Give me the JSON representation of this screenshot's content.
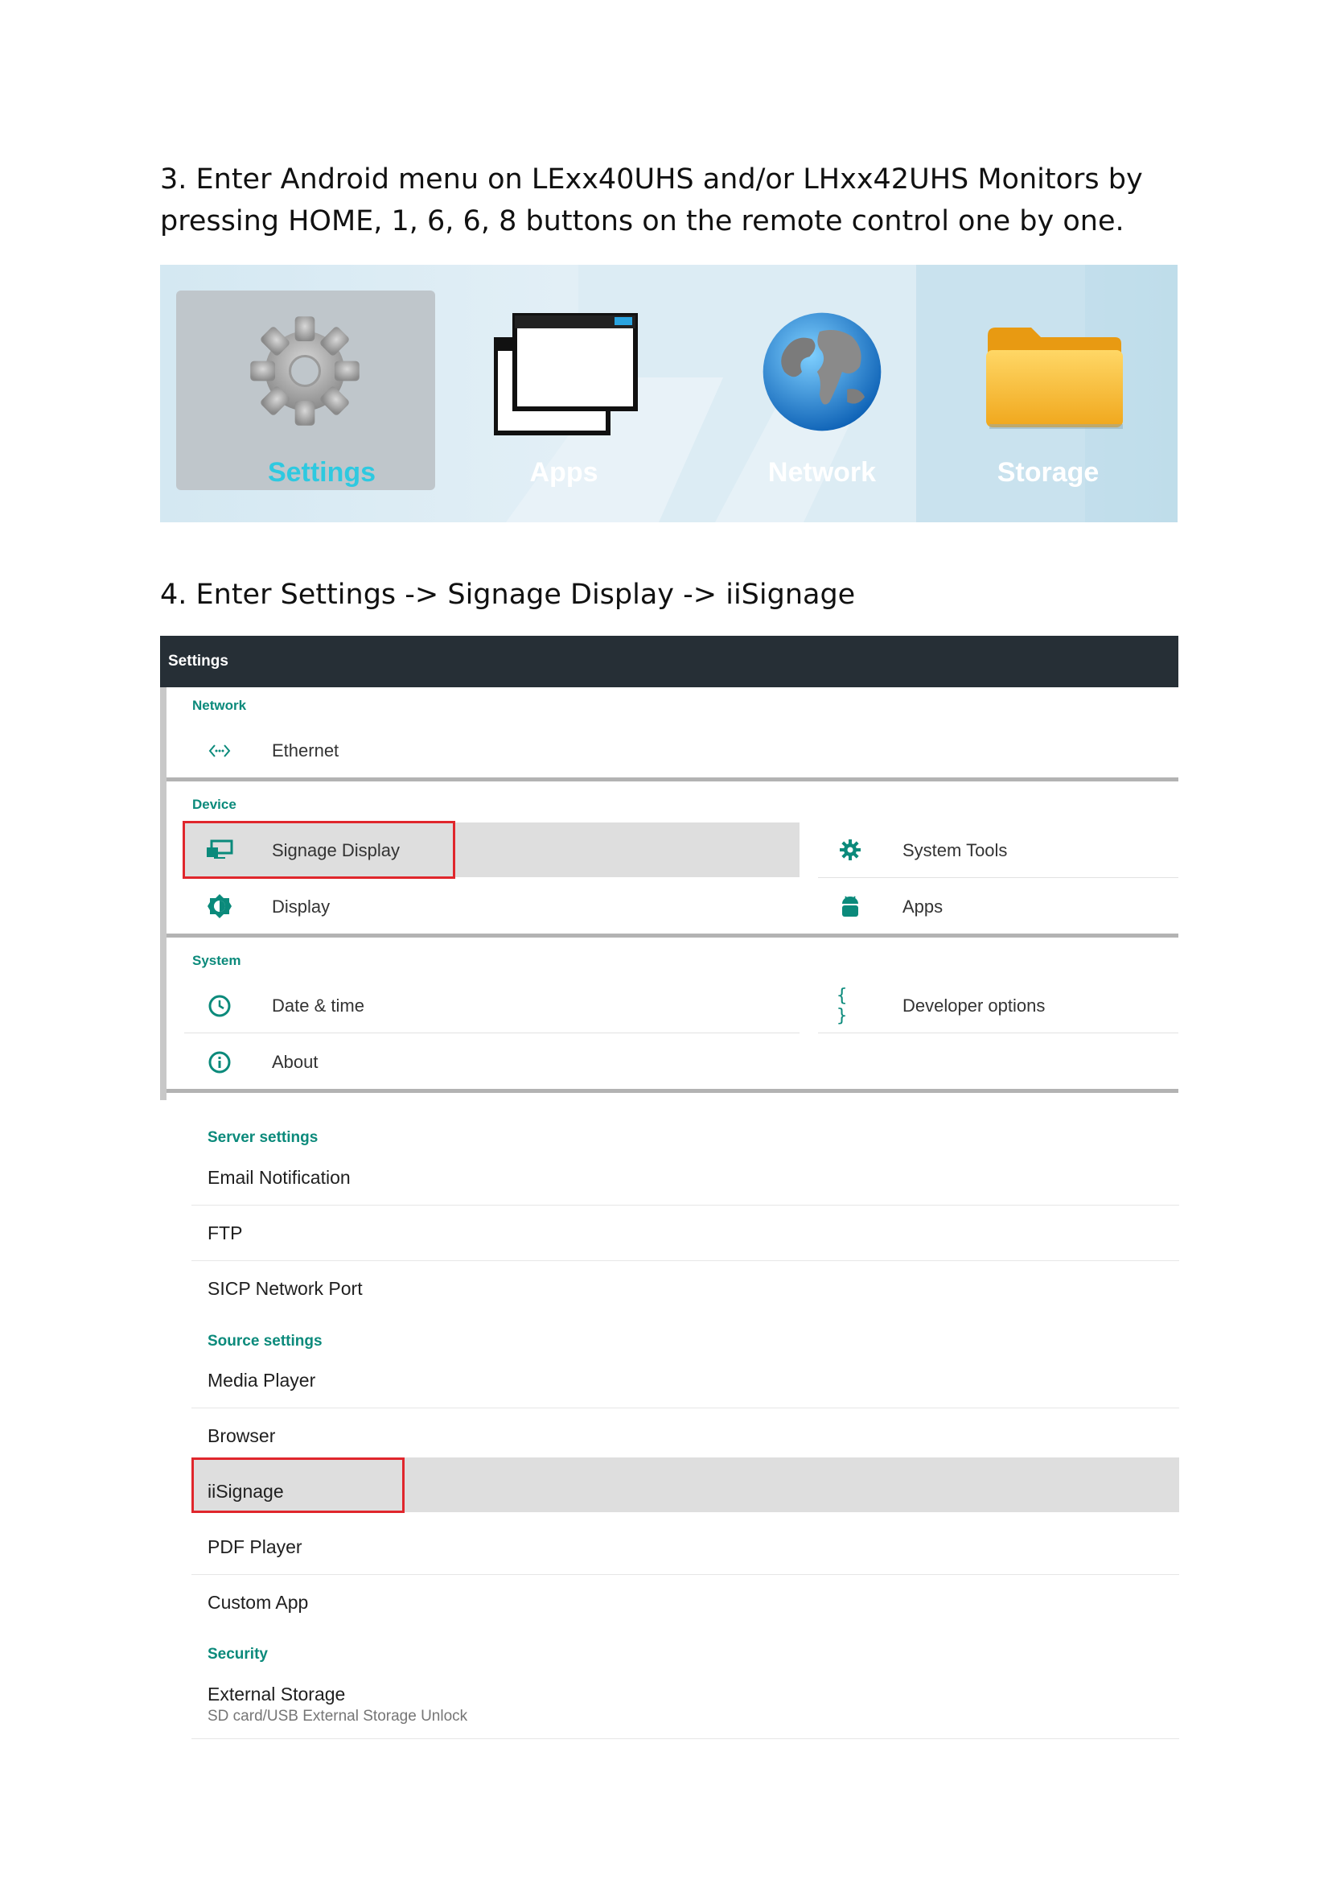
{
  "step3": {
    "line1": "3.  Enter Android menu on LExx40UHS and/or LHxx42UHS Monitors by",
    "line2": "pressing HOME, 1, 6, 6, 8 buttons on the remote control one by one."
  },
  "launcher": {
    "tiles": [
      {
        "label": "Settings",
        "icon": "gear-icon",
        "selected": true
      },
      {
        "label": "Apps",
        "icon": "windows-icon"
      },
      {
        "label": "Network",
        "icon": "globe-icon"
      },
      {
        "label": "Storage",
        "icon": "folder-icon"
      }
    ]
  },
  "step4": {
    "text": "4. Enter Settings -> Signage Display -> iiSignage"
  },
  "settings": {
    "title": "Settings",
    "sections": {
      "network": {
        "header": "Network",
        "items": [
          {
            "label": "Ethernet",
            "icon": "ethernet-icon"
          }
        ]
      },
      "device": {
        "header": "Device",
        "items": [
          {
            "label": "Signage Display",
            "icon": "signage-display-icon",
            "highlighted": true
          },
          {
            "label": "System Tools",
            "icon": "gear-icon"
          },
          {
            "label": "Display",
            "icon": "brightness-icon"
          },
          {
            "label": "Apps",
            "icon": "android-icon"
          }
        ]
      },
      "system": {
        "header": "System",
        "items": [
          {
            "label": "Date & time",
            "icon": "clock-icon"
          },
          {
            "label": "Developer options",
            "icon": "braces-icon",
            "icon_text": "{ }"
          },
          {
            "label": "About",
            "icon": "info-icon"
          }
        ]
      }
    },
    "accent": "#0b8a7b",
    "highlight": "#e0262c"
  },
  "signage_list": {
    "sections": [
      {
        "header": "Server settings",
        "items": [
          "Email Notification",
          "FTP",
          "SICP Network Port"
        ]
      },
      {
        "header": "Source settings",
        "items": [
          "Media Player",
          "Browser",
          "iiSignage",
          "PDF Player",
          "Custom App"
        ]
      },
      {
        "header": "Security",
        "items": [
          "External Storage"
        ],
        "subtitle": "SD card/USB External Storage Unlock"
      }
    ],
    "selected": "iiSignage"
  }
}
